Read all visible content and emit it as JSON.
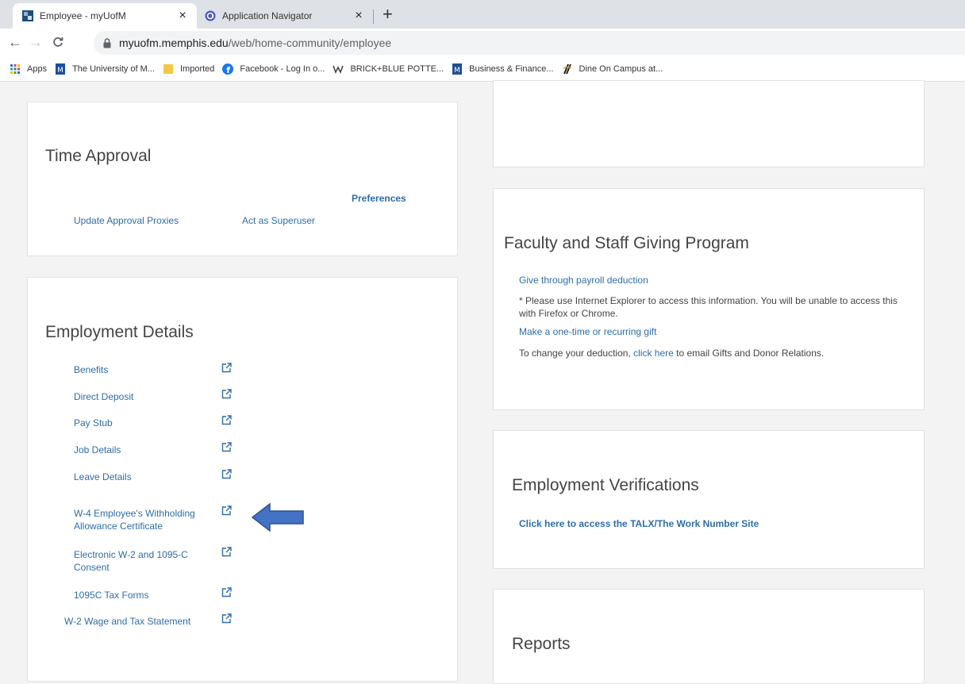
{
  "browser": {
    "tabs": [
      {
        "title": "Employee - myUofM",
        "active": true
      },
      {
        "title": "Application Navigator",
        "active": false
      }
    ],
    "url_host": "myuofm.memphis.edu",
    "url_path": "/web/home-community/employee",
    "bookmarks": [
      {
        "label": "Apps",
        "icon": "apps-grid-icon"
      },
      {
        "label": "The University of M...",
        "icon": "uofm-icon"
      },
      {
        "label": "Imported",
        "icon": "folder-icon"
      },
      {
        "label": "Facebook - Log In o...",
        "icon": "facebook-icon"
      },
      {
        "label": "BRICK+BLUE POTTE...",
        "icon": "brick-blue-icon"
      },
      {
        "label": "Business & Finance...",
        "icon": "uofm-icon"
      },
      {
        "label": "Dine On Campus at...",
        "icon": "dine-icon"
      }
    ]
  },
  "time_approval": {
    "title": "Time Approval",
    "preferences": "Preferences",
    "update_proxies": "Update Approval Proxies",
    "act_superuser": "Act as Superuser"
  },
  "employment_details": {
    "title": "Employment Details",
    "items": [
      {
        "line1": "Benefits",
        "line2": ""
      },
      {
        "line1": "Direct Deposit",
        "line2": ""
      },
      {
        "line1": "Pay Stub",
        "line2": ""
      },
      {
        "line1": "Job Details",
        "line2": ""
      },
      {
        "line1": "Leave Details",
        "line2": ""
      },
      {
        "line1": "W-4 Employee's Withholding",
        "line2": "Allowance Certificate"
      },
      {
        "line1": "Electronic W-2 and 1095-C",
        "line2": "Consent"
      },
      {
        "line1": "1095C Tax Forms",
        "line2": ""
      },
      {
        "line1": "W-2 Wage and Tax Statement",
        "line2": ""
      }
    ]
  },
  "giving": {
    "title": "Faculty and Staff Giving Program",
    "payroll_link": "Give through payroll deduction",
    "note_line1": "* Please use Internet Explorer to access this information. You will be unable to access this",
    "note_line2": "with Firefox or Chrome.",
    "gift_link": "Make a one-time or recurring gift",
    "change_prefix": "To change your deduction,",
    "change_link": "click here",
    "change_suffix": "to email Gifts and Donor Relations."
  },
  "verifications": {
    "title": "Employment Verifications",
    "talx_link": "Click here to access the TALX/The Work Number Site"
  },
  "reports": {
    "title": "Reports"
  },
  "colors": {
    "link": "#2f6da8",
    "annotation_arrow": "#4472c4"
  }
}
